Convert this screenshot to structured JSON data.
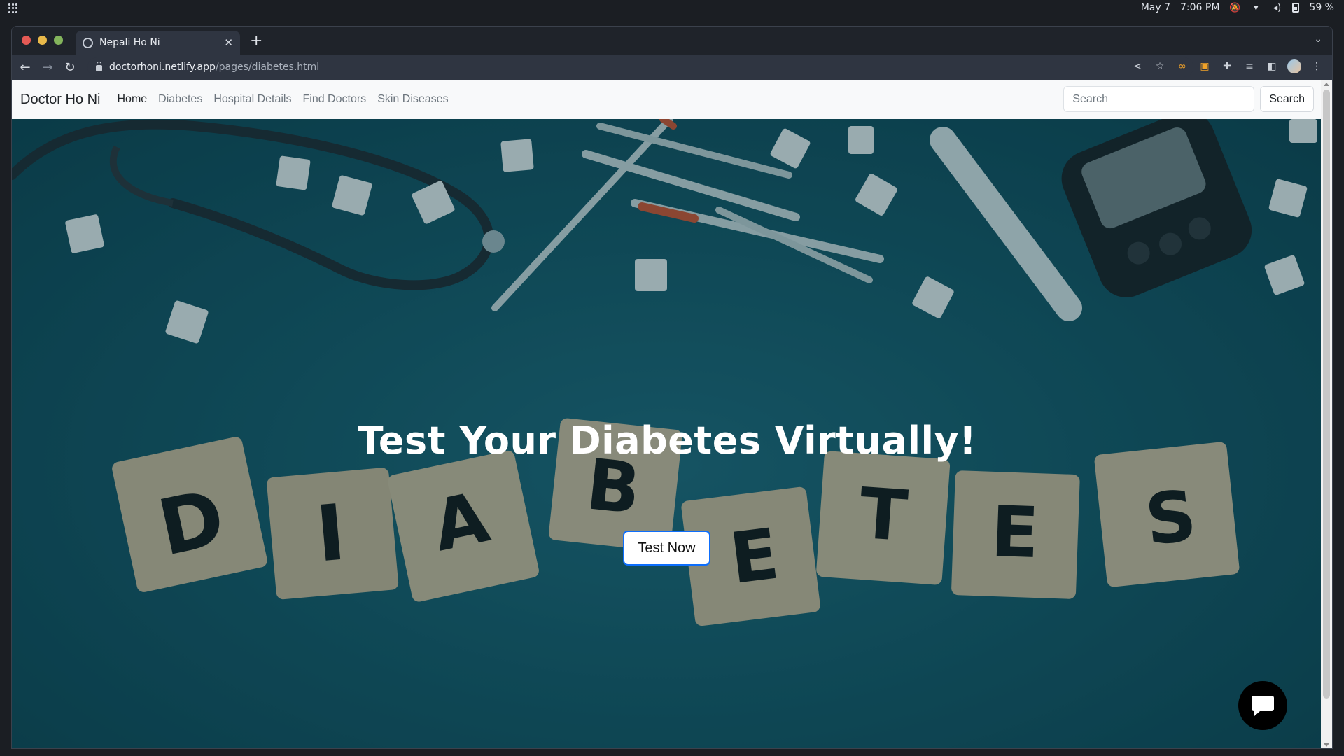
{
  "os": {
    "date": "May 7",
    "time": "7:06 PM",
    "battery": "59 %"
  },
  "browser": {
    "tab_title": "Nepali Ho Ni",
    "url_host": "doctorhoni.netlify.app",
    "url_path": "/pages/diabetes.html"
  },
  "site": {
    "brand": "Doctor Ho Ni",
    "nav": [
      "Home",
      "Diabetes",
      "Hospital Details",
      "Find Doctors",
      "Skin Diseases"
    ],
    "active_nav": "Home",
    "search_placeholder": "Search",
    "search_button": "Search"
  },
  "hero": {
    "title": "Test Your Diabetes Virtually!",
    "button": "Test Now",
    "blocks": [
      "D",
      "I",
      "A",
      "B",
      "E",
      "T",
      "E",
      "S"
    ]
  },
  "colors": {
    "hero_bg": "#135463",
    "button_border": "#0d6efd"
  }
}
